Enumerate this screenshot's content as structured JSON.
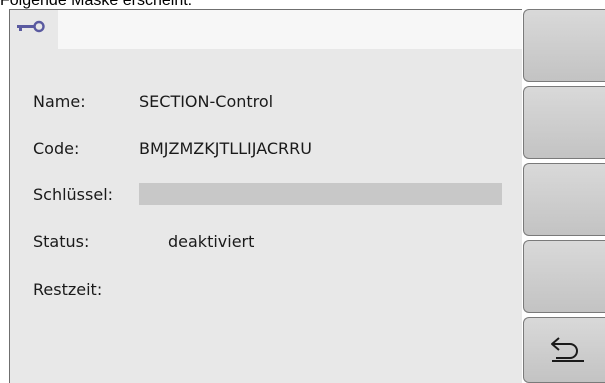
{
  "caption": "Folgende Maske erscheint:",
  "header": {
    "tab_icon": "key-icon"
  },
  "fields": {
    "name_label": "Name:",
    "name_value": "SECTION-Control",
    "code_label": "Code:",
    "code_value": "BMJZMZKJTLLIJACRRU",
    "key_label": "Schlüssel:",
    "key_value": "",
    "status_label": "Status:",
    "status_value": "deaktiviert",
    "remaining_label": "Restzeit:",
    "remaining_value": ""
  },
  "softkeys": {
    "back_icon": "return-arrow-icon"
  },
  "colors": {
    "screen_bg": "#e8e8e8",
    "tab_bar_bg": "#f7f7f7",
    "key_input_bg": "#c8c8c8",
    "icon_color": "#5a5aa0"
  }
}
